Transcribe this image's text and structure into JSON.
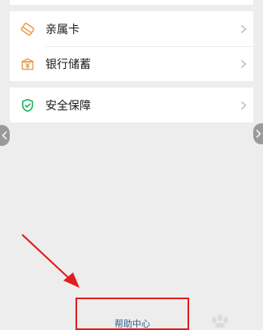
{
  "menu": {
    "group_relative": {
      "items": [
        {
          "label": "亲属卡",
          "icon": "relative-card-icon",
          "icon_color": "#f0a04b"
        },
        {
          "label": "银行储蓄",
          "icon": "bank-savings-icon",
          "icon_color": "#e6a15a"
        }
      ]
    },
    "group_security": {
      "items": [
        {
          "label": "安全保障",
          "icon": "shield-check-icon",
          "icon_color": "#19b35c"
        }
      ]
    }
  },
  "footer": {
    "help_center_label": "帮助中心",
    "annotation_color": "#e11d1d"
  }
}
